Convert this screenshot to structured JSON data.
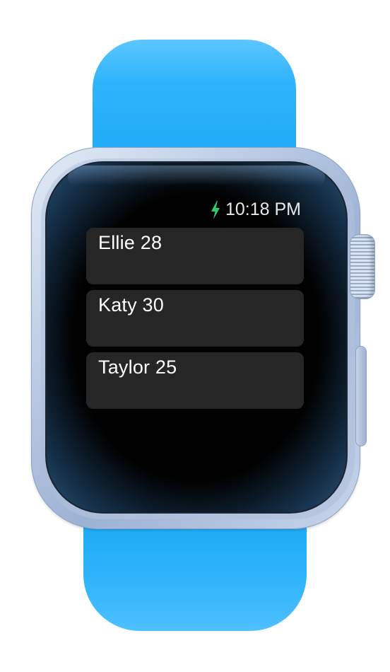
{
  "status_bar": {
    "time": "10:18 PM",
    "charging_icon": "bolt-icon",
    "charging_color": "#2ecc71"
  },
  "list": {
    "items": [
      {
        "label": "Ellie 28"
      },
      {
        "label": "Katy 30"
      },
      {
        "label": "Taylor 25"
      }
    ]
  },
  "theme": {
    "band_color": "#1aa8f5",
    "row_background": "#262626",
    "screen_background": "#000000"
  }
}
